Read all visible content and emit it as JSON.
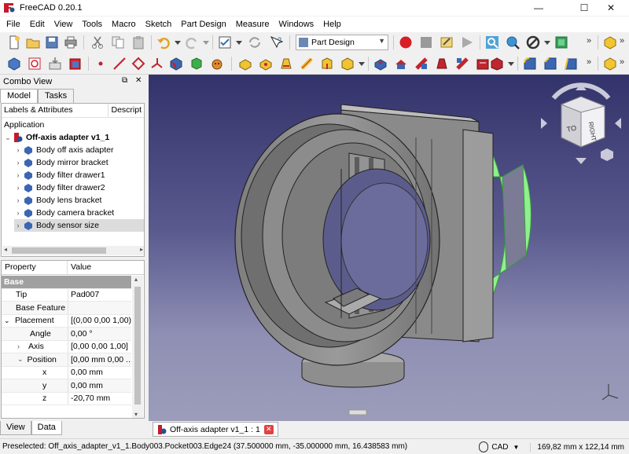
{
  "app": {
    "title": "FreeCAD 0.20.1"
  },
  "window_controls": {
    "minimize": "—",
    "maximize": "☐",
    "close": "✕"
  },
  "menu": [
    "File",
    "Edit",
    "View",
    "Tools",
    "Macro",
    "Sketch",
    "Part Design",
    "Measure",
    "Windows",
    "Help"
  ],
  "toolbar": {
    "workbench": "Part Design",
    "overflow": "»"
  },
  "combo_view": {
    "title": "Combo View",
    "float_icon": "⧉",
    "close_icon": "✕",
    "tabs": [
      "Model",
      "Tasks"
    ],
    "tree": {
      "col_labels": "Labels & Attributes",
      "col_desc": "Descript",
      "root_label": "Application",
      "document": "Off-axis adapter v1_1",
      "items": [
        "Body off axis adapter",
        "Body mirror bracket",
        "Body filter drawer1",
        "Body filter drawer2",
        "Body lens bracket",
        "Body camera bracket",
        "Body sensor size"
      ],
      "selected_index": 6
    },
    "properties": {
      "header": {
        "property": "Property",
        "value": "Value"
      },
      "group": "Base",
      "rows": [
        {
          "name": "Tip",
          "value": "Pad007"
        },
        {
          "name": "Base Feature",
          "value": ""
        },
        {
          "name": "Placement",
          "value": "[(0,00 0,00 1,00);..."
        },
        {
          "name": "Angle",
          "value": "0,00 °"
        },
        {
          "name": "Axis",
          "value": "[0,00 0,00 1,00]"
        },
        {
          "name": "Position",
          "value": "[0,00 mm  0,00 ..."
        },
        {
          "name": "x",
          "value": "0,00 mm"
        },
        {
          "name": "y",
          "value": "0,00 mm"
        },
        {
          "name": "z",
          "value": "-20,70 mm"
        }
      ]
    },
    "bottom_tabs": [
      "View",
      "Data"
    ]
  },
  "viewport": {
    "document_tab": "Off-axis adapter v1_1 : 1",
    "navcube_face": "RIGHT",
    "colors": {
      "model": "#8a8a8a",
      "preselect": "#7de87d",
      "bg_top": "#33336b",
      "bg_bottom": "#9c9cba"
    }
  },
  "status": {
    "message": "Preselected: Off_axis_adapter_v1_1.Body003.Pocket003.Edge24 (37.500000 mm, -35.000000 mm, 16.438583 mm)",
    "nav_style": "CAD",
    "dimensions": "169,82 mm x 122,14 mm"
  }
}
